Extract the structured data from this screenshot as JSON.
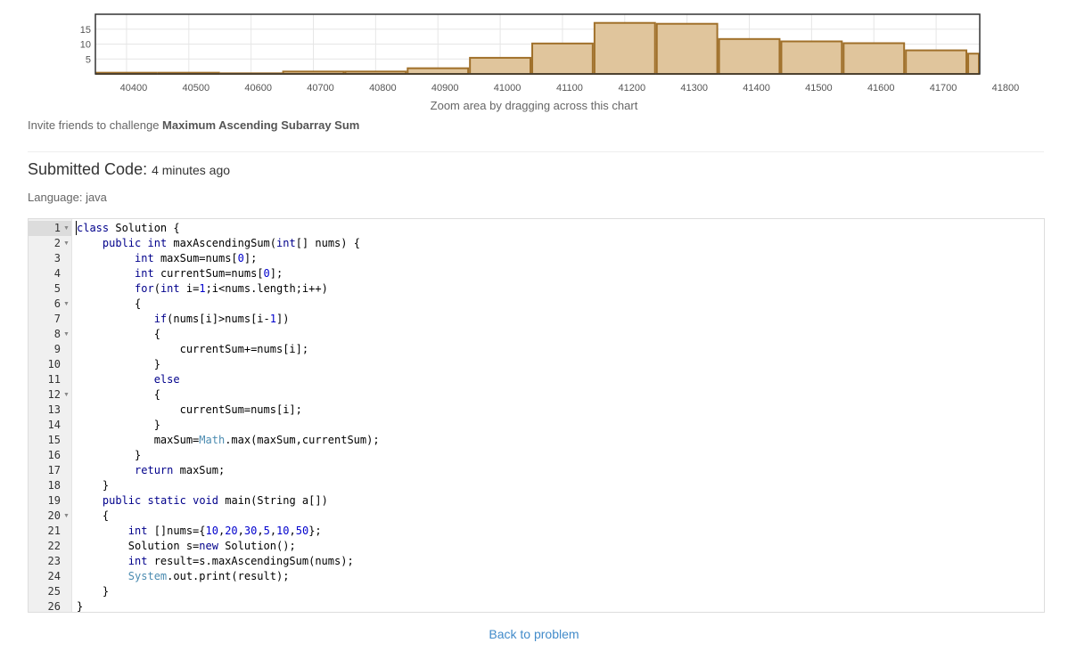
{
  "chart_data": {
    "type": "bar",
    "categories": [
      "40400",
      "40500",
      "40600",
      "40700",
      "40800",
      "40900",
      "41000",
      "41100",
      "41200",
      "41300",
      "41400",
      "41500",
      "41600",
      "41700",
      "41800"
    ],
    "values": [
      0.4,
      0.4,
      0.2,
      0.8,
      0.8,
      1.9,
      5.4,
      10.2,
      17.1,
      16.8,
      11.7,
      10.9,
      10.3,
      7.9,
      6.8
    ],
    "yticks": [
      5,
      10,
      15
    ],
    "ylim": [
      0,
      20
    ],
    "xlabel": "",
    "ylabel": "",
    "title": "",
    "grid": true,
    "colors": {
      "fill": "#e0c59c",
      "stroke": "#a0702a"
    }
  },
  "zoom_hint": "Zoom area by dragging across this chart",
  "invite": {
    "prefix": "Invite friends to challenge ",
    "problem": "Maximum Ascending Subarray Sum"
  },
  "submission": {
    "title": "Submitted Code: ",
    "time": "4 minutes ago",
    "language": "Language: java"
  },
  "code": {
    "lines": [
      "class Solution {",
      "    public int maxAscendingSum(int[] nums) {",
      "         int maxSum=nums[0];",
      "         int currentSum=nums[0];",
      "         for(int i=1;i<nums.length;i++)",
      "         {",
      "            if(nums[i]>nums[i-1])",
      "            {",
      "                currentSum+=nums[i];",
      "            }",
      "            else",
      "            {",
      "                currentSum=nums[i];",
      "            }",
      "            maxSum=Math.max(maxSum,currentSum);",
      "         }",
      "         return maxSum;",
      "    }",
      "    public static void main(String a[])",
      "    {",
      "        int []nums={10,20,30,5,10,50};",
      "        Solution s=new Solution();",
      "        int result=s.maxAscendingSum(nums);",
      "        System.out.print(result);",
      "    }",
      "}"
    ],
    "line_numbers": [
      "1",
      "2",
      "3",
      "4",
      "5",
      "6",
      "7",
      "8",
      "9",
      "10",
      "11",
      "12",
      "13",
      "14",
      "15",
      "16",
      "17",
      "18",
      "19",
      "20",
      "21",
      "22",
      "23",
      "24",
      "25",
      "26"
    ],
    "fold_lines": [
      1,
      2,
      6,
      8,
      12,
      20
    ]
  },
  "back_link": "Back to problem"
}
